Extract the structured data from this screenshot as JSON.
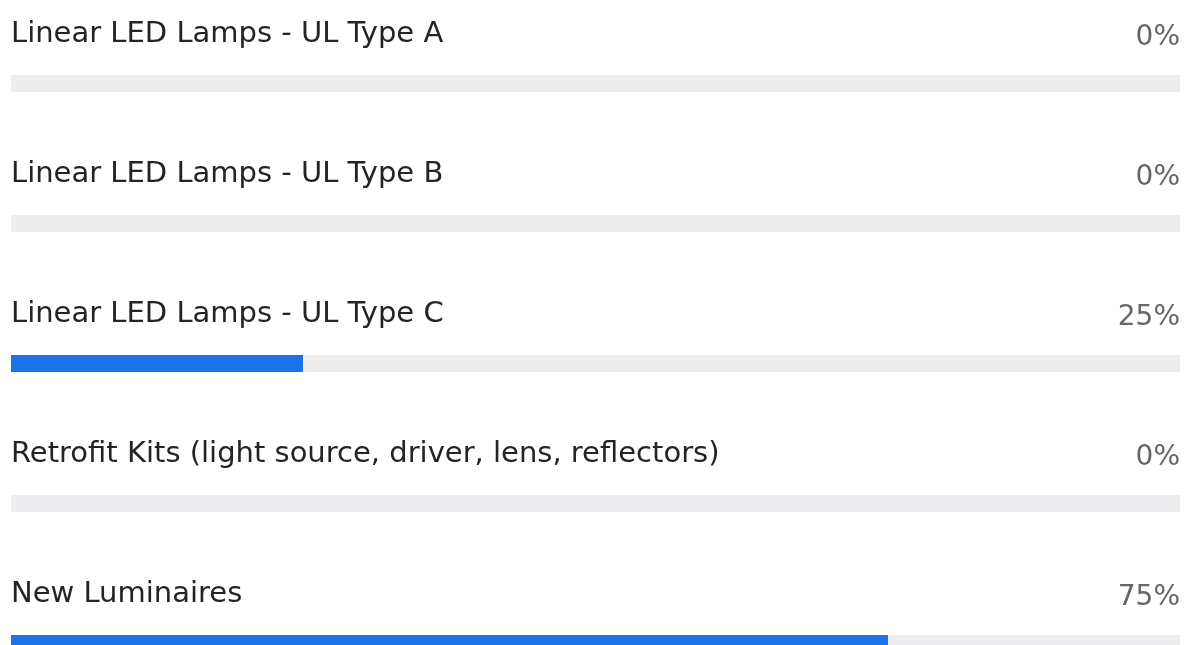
{
  "items": [
    {
      "label": "Linear LED Lamps - UL Type A",
      "percent": "0%",
      "level": 0
    },
    {
      "label": "Linear LED Lamps - UL Type B",
      "percent": "0%",
      "level": 0
    },
    {
      "label": "Linear LED Lamps - UL Type C",
      "percent": "25%",
      "level": 0.25
    },
    {
      "label": "Retrofit Kits (light source, driver, lens, reflectors)",
      "percent": "0%",
      "level": 0
    },
    {
      "label": "New Luminaires",
      "percent": "75%",
      "level": 0.75
    }
  ]
}
